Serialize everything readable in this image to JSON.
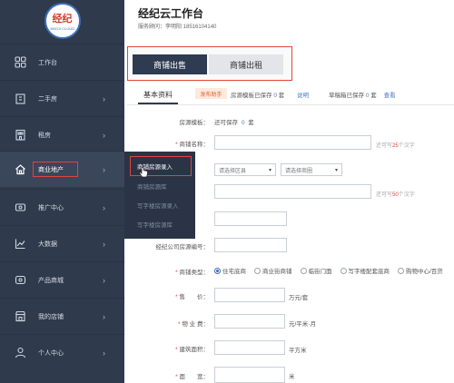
{
  "logo": {
    "text": "经纪",
    "sub": "JINGJI CLOUD"
  },
  "header": {
    "title": "经纪云工作台",
    "subtitle": "服务顾问：李明阳 18516104140"
  },
  "sidebar": {
    "items": [
      {
        "label": "工作台",
        "icon": "grid-icon"
      },
      {
        "label": "二手房",
        "icon": "building-icon"
      },
      {
        "label": "租房",
        "icon": "apartment-icon"
      },
      {
        "label": "商业地产",
        "icon": "home-icon"
      },
      {
        "label": "推广中心",
        "icon": "megaphone-icon"
      },
      {
        "label": "大数据",
        "icon": "chart-icon"
      },
      {
        "label": "产品商城",
        "icon": "cart-icon"
      },
      {
        "label": "我的店铺",
        "icon": "store-icon"
      },
      {
        "label": "个人中心",
        "icon": "user-icon"
      }
    ],
    "chevron": "›"
  },
  "submenu": {
    "items": [
      "商铺房源录入",
      "商铺房源库",
      "写字楼房源录入",
      "写字楼房源库"
    ]
  },
  "tabs": {
    "sell": "商铺出售",
    "rent": "商铺出租"
  },
  "section": {
    "basic_info": "基本资料",
    "assist_btn": "发布助手",
    "template_note": "房源模板已保存",
    "template_count": "0",
    "template_unit": "套",
    "explain": "说明",
    "draft_note": "草稿箱已保存",
    "draft_count": "0",
    "draft_unit": "套",
    "view": "查看"
  },
  "form": {
    "template_label": "房源模板：",
    "template_value_prefix": "还可保存",
    "template_value_count": "0",
    "template_value_unit": "套",
    "name_label": "商铺名称：",
    "name_hint_prefix": "还可写",
    "name_hint_count": "25",
    "name_hint_suffix": "个汉字",
    "region_placeholder": "请选择区县",
    "area_placeholder": "请选择商圈",
    "addr_hint_prefix": "还可写",
    "addr_hint_count": "50",
    "addr_hint_suffix": "个汉字",
    "code_label": "经纪公司房源编号：",
    "type_label": "商铺类型：",
    "types": [
      "住宅底商",
      "商业街商铺",
      "临街门面",
      "写字楼配套底商",
      "购物中心/百货"
    ],
    "price_label": "售　　价：",
    "price_unit": "万元/套",
    "fee_label": "物 业 费：",
    "fee_unit": "元/平米·月",
    "area_label": "建筑面积：",
    "area_unit": "平方米",
    "width_label": "面　　宽：",
    "width_unit": "米"
  }
}
